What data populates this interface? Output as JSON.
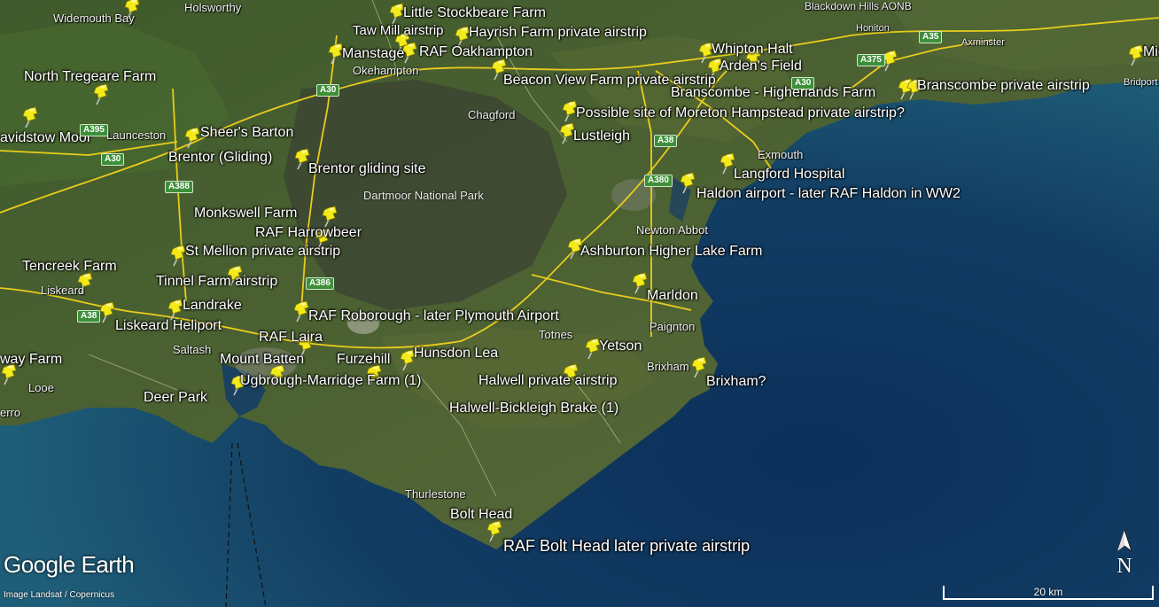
{
  "app": "Google Earth",
  "credit": "Image Landsat / Copernicus",
  "scale_label": "20 km",
  "compass_label": "N",
  "colors": {
    "sea_dark": "#0d2a4a",
    "sea_light": "#1d5a7a",
    "land": "#4a5a2e",
    "moor": "#3f4630",
    "road": "#f2d21b",
    "pin": "#f3ea1c"
  },
  "pins": [
    {
      "label": "Little Stockbeare Farm"
    },
    {
      "label": "Hayrish Farm private airstrip"
    },
    {
      "label": "Taw Mill airstrip"
    },
    {
      "label": "Manstage"
    },
    {
      "label": "RAF Oakhampton"
    },
    {
      "label": "Beacon View Farm private airstrip"
    },
    {
      "label": "Whipton Halt"
    },
    {
      "label": "Arden's Field"
    },
    {
      "label": "Branscombe - Higherlands Farm"
    },
    {
      "label": "Branscombe private airstrip"
    },
    {
      "label": "Possible site of Moreton Hampstead private airstrip?"
    },
    {
      "label": "Lustleigh"
    },
    {
      "label": "Langford Hospital"
    },
    {
      "label": "Haldon airport - later RAF Haldon in WW2"
    },
    {
      "label": "North Tregeare Farm"
    },
    {
      "label": "Sheer's Barton"
    },
    {
      "label": "Brentor (Gliding)"
    },
    {
      "label": "Brentor gliding site"
    },
    {
      "label": "Monkswell Farm"
    },
    {
      "label": "RAF Harrowbeer"
    },
    {
      "label": "St Mellion private airstrip"
    },
    {
      "label": "Tencreek Farm"
    },
    {
      "label": "Tinnel Farm airstrip"
    },
    {
      "label": "Landrake"
    },
    {
      "label": "Liskeard Heliport"
    },
    {
      "label": "RAF Roborough - later Plymouth Airport"
    },
    {
      "label": "RAF Laira"
    },
    {
      "label": "Mount Batten"
    },
    {
      "label": "Furzehill"
    },
    {
      "label": "Hunsdon Lea"
    },
    {
      "label": "Ugbrough-Marridge Farm (1)"
    },
    {
      "label": "Halwell private airstrip"
    },
    {
      "label": "Halwell-Bickleigh Brake (1)"
    },
    {
      "label": "Deer Park"
    },
    {
      "label": "Ashburton Higher Lake Farm"
    },
    {
      "label": "Marldon"
    },
    {
      "label": "Yetson"
    },
    {
      "label": "Brixham?"
    },
    {
      "label": "Bolt Head"
    },
    {
      "label": "RAF Bolt Head later private airstrip"
    },
    {
      "label": "way Farm"
    },
    {
      "label": "Mic"
    }
  ],
  "towns": [
    "Widemouth Bay",
    "Holsworthy",
    "Okehampton",
    "Chagford",
    "Launceston",
    "avidstow Moor",
    "Exmouth",
    "Newton Abbot",
    "Liskeard",
    "Saltash",
    "Totnes",
    "Paignton",
    "Brixham",
    "Looe",
    "erro",
    "Thurlestone",
    "Honiton",
    "Axminster",
    "Bridport",
    "Blackdown Hills AONB"
  ],
  "park": "Dartmoor National Park",
  "roads": [
    "A30",
    "A395",
    "A30",
    "A388",
    "A386",
    "A38",
    "A38",
    "A380",
    "A375",
    "A35",
    "A30"
  ]
}
